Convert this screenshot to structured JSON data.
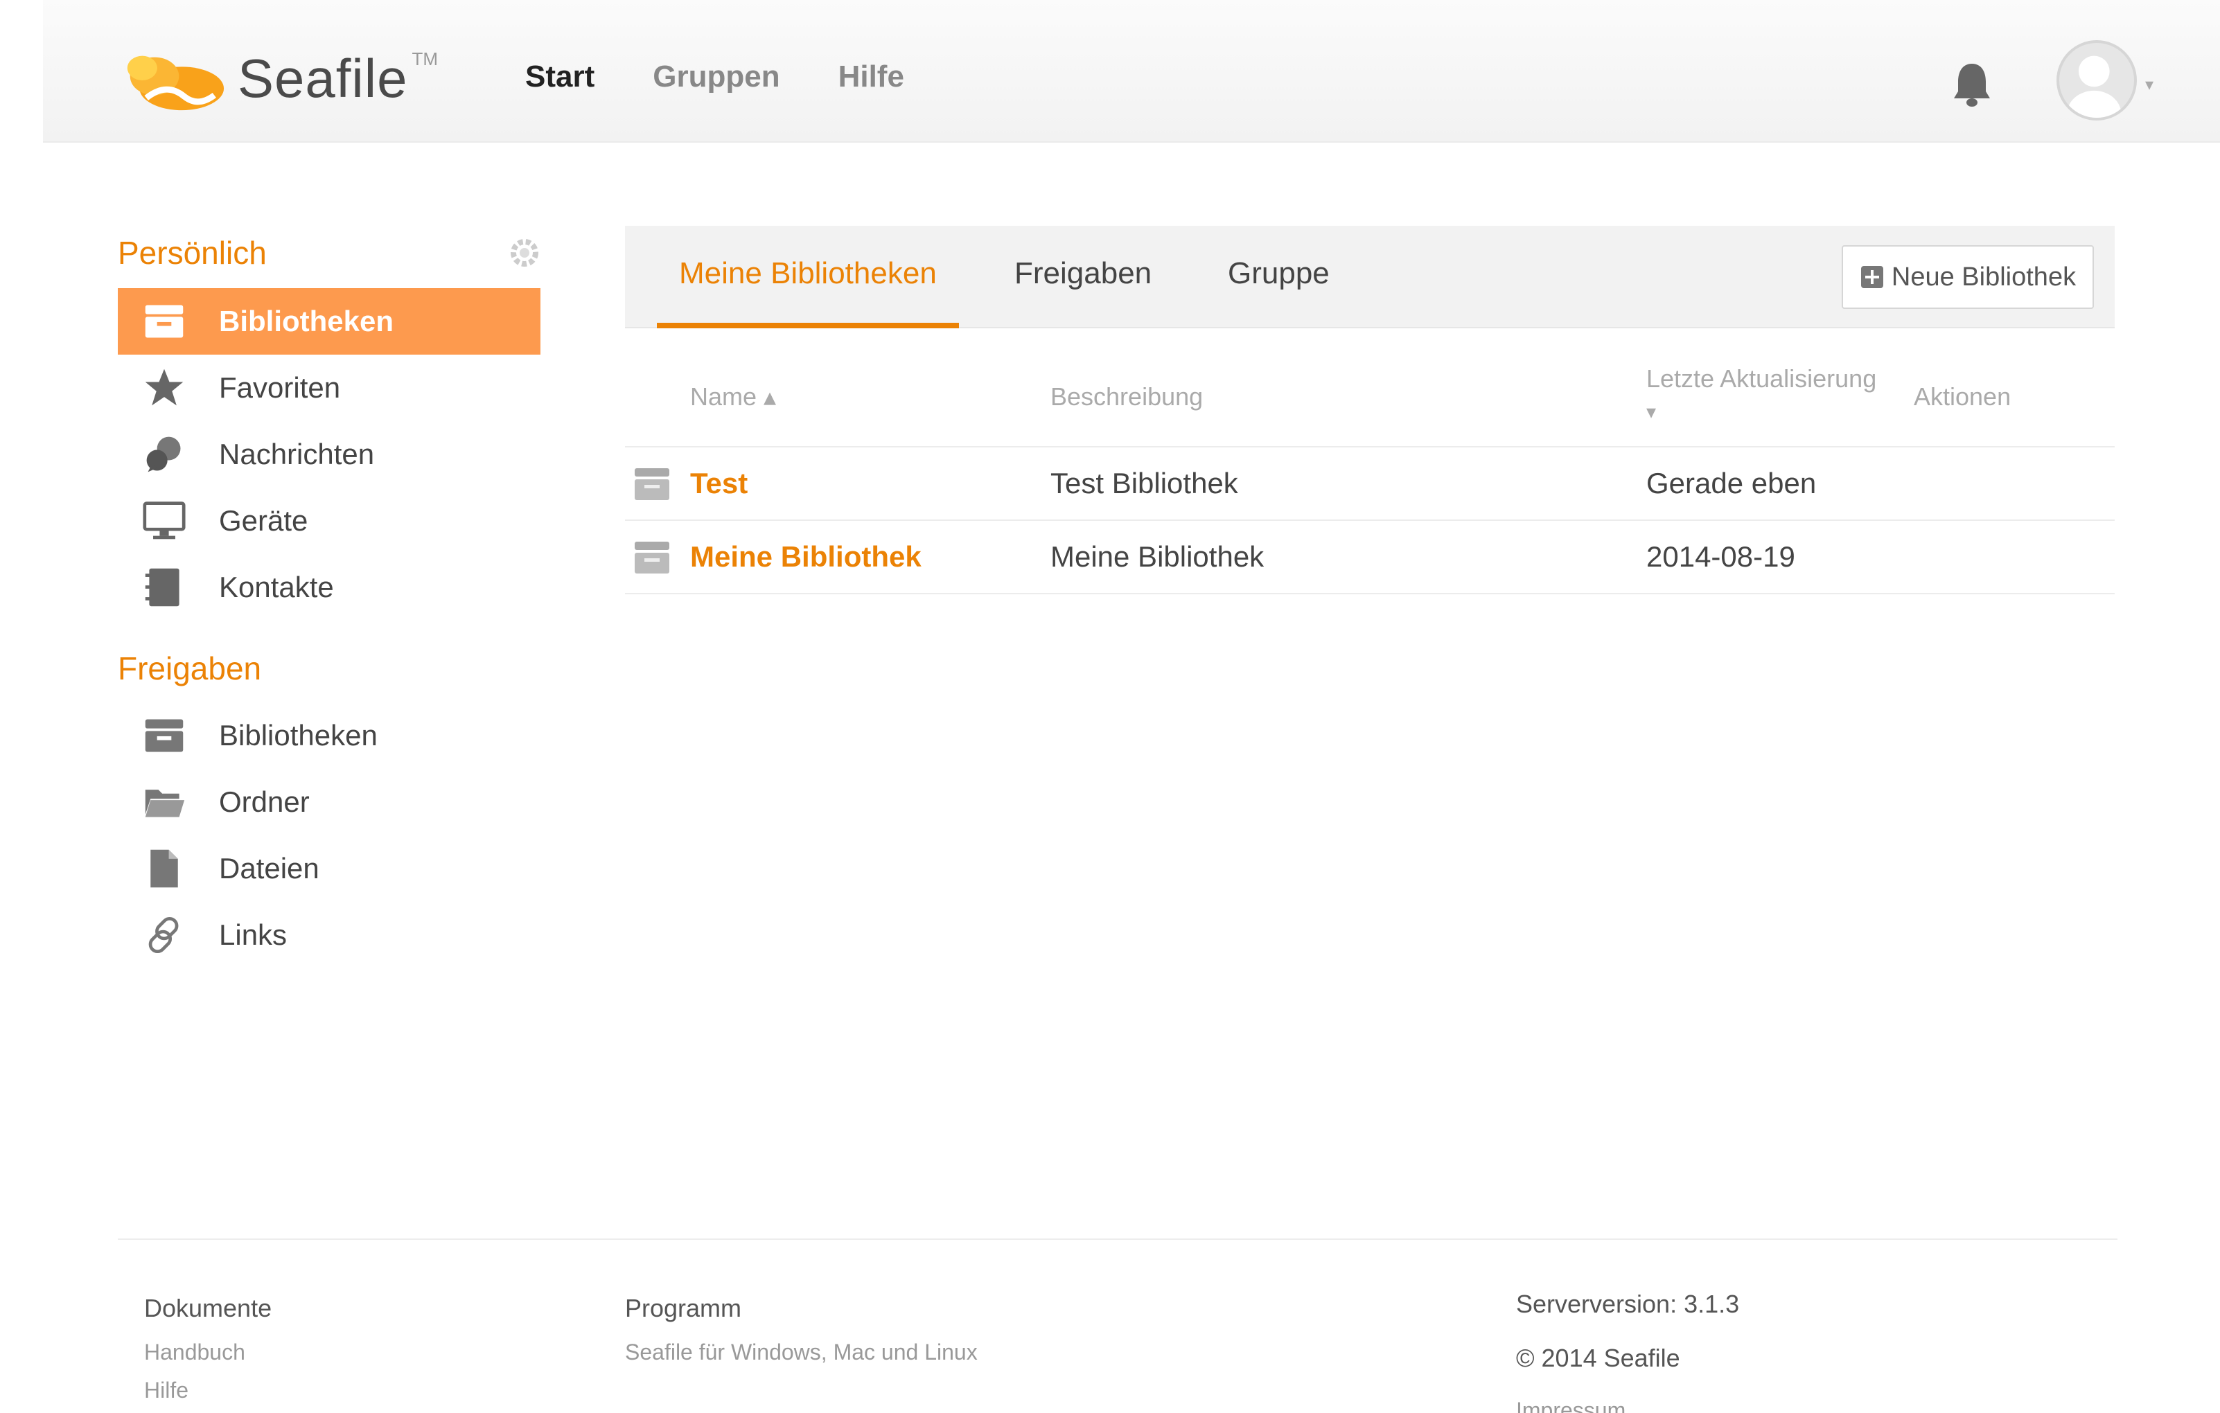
{
  "header": {
    "logo_text": "Seafile",
    "logo_tm": "TM",
    "nav": [
      {
        "label": "Start",
        "active": true
      },
      {
        "label": "Gruppen",
        "active": false
      },
      {
        "label": "Hilfe",
        "active": false
      }
    ],
    "icons": {
      "notifications": "bell-icon",
      "user": "avatar-icon"
    }
  },
  "sidebar": {
    "personal_heading": "Persönlich",
    "personal_items": [
      {
        "label": "Bibliotheken",
        "icon": "library-icon",
        "active": true
      },
      {
        "label": "Favoriten",
        "icon": "star-icon",
        "active": false
      },
      {
        "label": "Nachrichten",
        "icon": "chat-icon",
        "active": false
      },
      {
        "label": "Geräte",
        "icon": "monitor-icon",
        "active": false
      },
      {
        "label": "Kontakte",
        "icon": "contacts-icon",
        "active": false
      }
    ],
    "shared_heading": "Freigaben",
    "shared_items": [
      {
        "label": "Bibliotheken",
        "icon": "library-icon"
      },
      {
        "label": "Ordner",
        "icon": "folder-icon"
      },
      {
        "label": "Dateien",
        "icon": "file-icon"
      },
      {
        "label": "Links",
        "icon": "link-icon"
      }
    ]
  },
  "main": {
    "tabs": [
      {
        "label": "Meine Bibliotheken",
        "active": true
      },
      {
        "label": "Freigaben",
        "active": false
      },
      {
        "label": "Gruppe",
        "active": false
      }
    ],
    "new_library_label": "Neue Bibliothek",
    "columns": {
      "name": "Name ▴",
      "description": "Beschreibung",
      "updated": "Letzte Aktualisierung",
      "updated_sort": "▾",
      "actions": "Aktionen"
    },
    "rows": [
      {
        "name": "Test",
        "description": "Test Bibliothek",
        "updated": "Gerade eben"
      },
      {
        "name": "Meine Bibliothek",
        "description": "Meine Bibliothek",
        "updated": "2014-08-19"
      }
    ]
  },
  "footer": {
    "docs_title": "Dokumente",
    "docs_links": [
      "Handbuch",
      "Hilfe"
    ],
    "program_title": "Programm",
    "program_link": "Seafile für Windows, Mac und Linux",
    "server_version": "Serverversion: 3.1.3",
    "copyright": "© 2014 Seafile",
    "imprint": "Impressum"
  },
  "colors": {
    "accent": "#eb8205",
    "active_bg": "#fd9a4e"
  }
}
